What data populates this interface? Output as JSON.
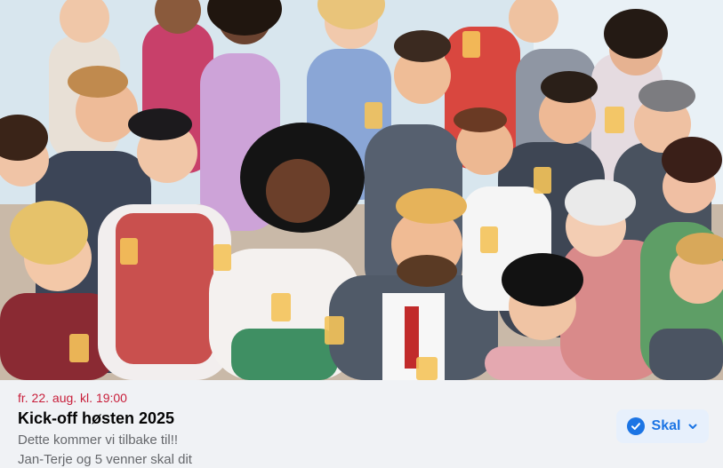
{
  "event": {
    "date": "fr. 22. aug. kl. 19:00",
    "title": "Kick-off høsten 2025",
    "description": "Dette kommer vi tilbake til!!",
    "friends_going": "Jan-Terje og 5 venner skal dit",
    "rsvp_label": "Skal",
    "cover_image": "illustration-party-crowd-singing-with-drinks"
  },
  "colors": {
    "date_red": "#c81e3a",
    "accent_blue": "#1b74e4",
    "button_bg": "#e7f0fc",
    "info_bg": "#f0f2f5",
    "muted_text": "#65676b"
  },
  "icons": {
    "rsvp": "check-circle-icon",
    "dropdown": "chevron-down-icon"
  }
}
